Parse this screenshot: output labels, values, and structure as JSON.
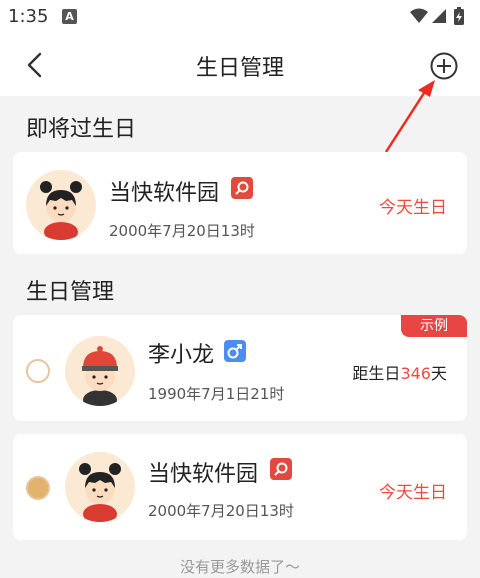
{
  "status_bar": {
    "time": "1:35",
    "notification_letter": "A"
  },
  "header": {
    "title": "生日管理",
    "back_icon": "chevron-left-icon",
    "add_icon": "plus-circle-icon"
  },
  "upcoming": {
    "section_title": "即将过生日",
    "items": [
      {
        "name": "当快软件园",
        "gender": "female",
        "date": "2000年7月20日13时",
        "status": "今天生日"
      }
    ]
  },
  "manage": {
    "section_title": "生日管理",
    "items": [
      {
        "name": "李小龙",
        "gender": "male",
        "date": "1990年7月1日21时",
        "badge": "示例",
        "status_prefix": "距生日",
        "status_days": "346",
        "status_suffix": "天"
      },
      {
        "name": "当快软件园",
        "gender": "female",
        "date": "2000年7月20日13时",
        "status": "今天生日"
      }
    ]
  },
  "footer": {
    "text": "没有更多数据了～"
  },
  "colors": {
    "accent_red": "#f04a3f",
    "badge_red": "#e84545",
    "male_blue": "#4a8ff0",
    "radio_gold": "#e4b26f"
  }
}
